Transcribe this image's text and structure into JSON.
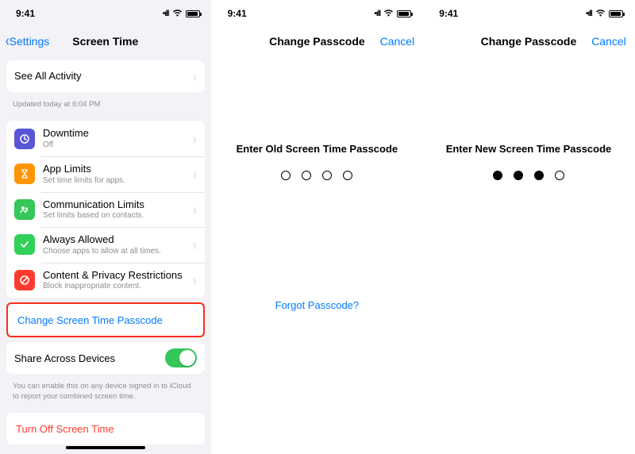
{
  "status": {
    "time": "9:41"
  },
  "screen1": {
    "back": "Settings",
    "title": "Screen Time",
    "seeAll": "See All Activity",
    "updated": "Updated today at 6:04 PM",
    "items": [
      {
        "title": "Downtime",
        "sub": "Off"
      },
      {
        "title": "App Limits",
        "sub": "Set time limits for apps."
      },
      {
        "title": "Communication Limits",
        "sub": "Set limits based on contacts."
      },
      {
        "title": "Always Allowed",
        "sub": "Choose apps to allow at all times."
      },
      {
        "title": "Content & Privacy Restrictions",
        "sub": "Block inappropriate content."
      }
    ],
    "changePasscode": "Change Screen Time Passcode",
    "share": "Share Across Devices",
    "shareFoot": "You can enable this on any device signed in to iCloud to report your combined screen time.",
    "turnOff": "Turn Off Screen Time"
  },
  "screen2": {
    "title": "Change Passcode",
    "cancel": "Cancel",
    "prompt": "Enter Old Screen Time Passcode",
    "dotsFilled": 0,
    "forgot": "Forgot Passcode?"
  },
  "screen3": {
    "title": "Change Passcode",
    "cancel": "Cancel",
    "prompt": "Enter New Screen Time Passcode",
    "dotsFilled": 3
  }
}
